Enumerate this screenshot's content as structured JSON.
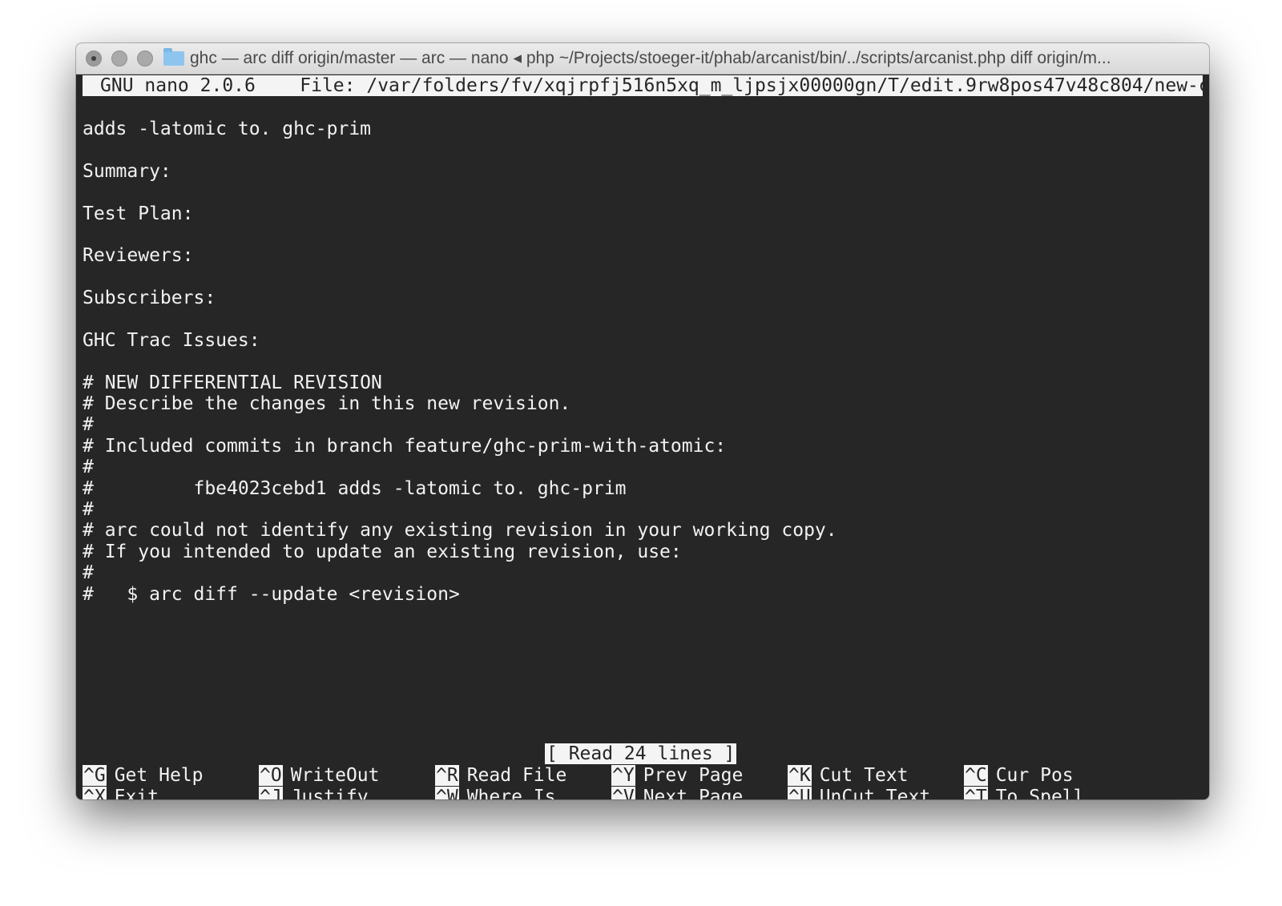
{
  "window": {
    "title": "ghc — arc diff origin/master — arc — nano ◂ php ~/Projects/stoeger-it/phab/arcanist/bin/../scripts/arcanist.php diff origin/m..."
  },
  "nano": {
    "version": "GNU nano 2.0.6",
    "file_label": "File: /var/folders/fv/xqjrpfj516n5xq_m_ljpsjx00000gn/T/edit.9rw8pos47v48c804/new-commit"
  },
  "editor": {
    "lines": [
      "adds -latomic to. ghc-prim",
      "",
      "Summary:",
      "",
      "Test Plan:",
      "",
      "Reviewers:",
      "",
      "Subscribers:",
      "",
      "GHC Trac Issues:",
      "",
      "# NEW DIFFERENTIAL REVISION",
      "# Describe the changes in this new revision.",
      "#",
      "# Included commits in branch feature/ghc-prim-with-atomic:",
      "#",
      "#         fbe4023cebd1 adds -latomic to. ghc-prim",
      "#",
      "# arc could not identify any existing revision in your working copy.",
      "# If you intended to update an existing revision, use:",
      "#",
      "#   $ arc diff --update <revision>"
    ]
  },
  "status": "[ Read 24 lines ]",
  "shortcuts": {
    "row1": [
      {
        "key": "^G",
        "label": "Get Help"
      },
      {
        "key": "^O",
        "label": "WriteOut"
      },
      {
        "key": "^R",
        "label": "Read File"
      },
      {
        "key": "^Y",
        "label": "Prev Page"
      },
      {
        "key": "^K",
        "label": "Cut Text"
      },
      {
        "key": "^C",
        "label": "Cur Pos"
      }
    ],
    "row2": [
      {
        "key": "^X",
        "label": "Exit"
      },
      {
        "key": "^J",
        "label": "Justify"
      },
      {
        "key": "^W",
        "label": "Where Is"
      },
      {
        "key": "^V",
        "label": "Next Page"
      },
      {
        "key": "^U",
        "label": "UnCut Text"
      },
      {
        "key": "^T",
        "label": "To Spell"
      }
    ]
  }
}
